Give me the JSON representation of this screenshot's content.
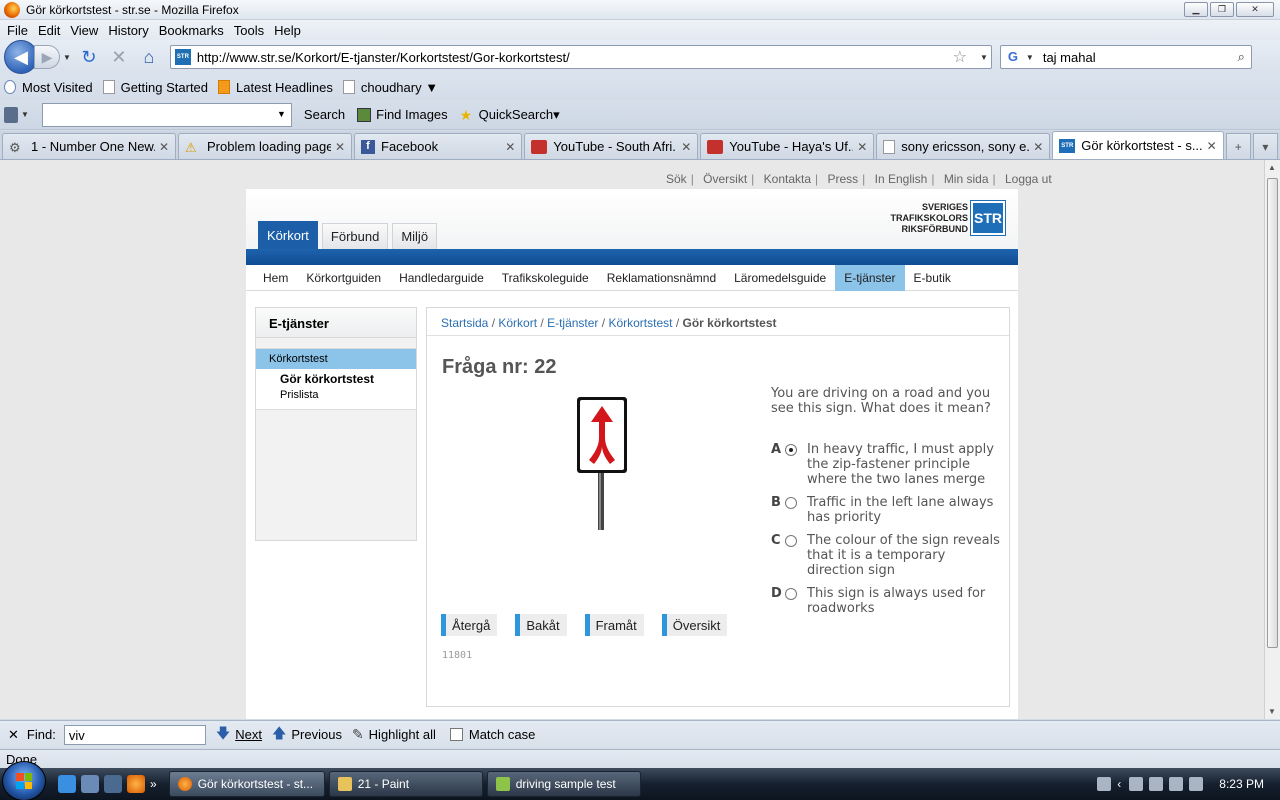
{
  "window": {
    "title": "Gör körkortstest - str.se - Mozilla Firefox"
  },
  "menubar": [
    "File",
    "Edit",
    "View",
    "History",
    "Bookmarks",
    "Tools",
    "Help"
  ],
  "navbar": {
    "url": "http://www.str.se/Korkort/E-tjanster/Korkortstest/Gor-korkortstest/",
    "search_value": "taj mahal"
  },
  "bookmarks": [
    "Most Visited",
    "Getting Started",
    "Latest Headlines",
    "choudhary ▼"
  ],
  "toolbar2": {
    "search_label": "Search",
    "find_images": "Find Images",
    "quicksearch": "QuickSearch▾"
  },
  "tabs": [
    "1 - Number One New...",
    "Problem loading page",
    "Facebook",
    "YouTube - South Afri...",
    "YouTube - Haya's Uf...",
    "sony ericsson, sony e...",
    "Gör körkortstest - s..."
  ],
  "site": {
    "util_links": [
      "Sök",
      "Översikt",
      "Kontakta",
      "Press",
      "In English",
      "Min sida",
      "Logga ut"
    ],
    "logo_lines": [
      "SVERIGES",
      "TRAFIKSKOLORS",
      "RIKSFÖRBUND"
    ],
    "logo_box": "STR",
    "main_nav": [
      "Körkort",
      "Förbund",
      "Miljö"
    ],
    "sub_nav": [
      "Hem",
      "Körkortguiden",
      "Handledarguide",
      "Trafikskoleguide",
      "Reklamationsnämnd",
      "Läromedelsguide",
      "E-tjänster",
      "E-butik"
    ],
    "sidebar": {
      "heading": "E-tjänster",
      "items": [
        "Körkortstest",
        "Gör körkortstest",
        "Prislista"
      ]
    },
    "breadcrumbs": [
      "Startsida",
      "Körkort",
      "E-tjänster",
      "Körkortstest",
      "Gör körkortstest"
    ],
    "question_title": "Fråga nr: 22",
    "question_text": "You are driving on a road and you see this sign. What does it mean?",
    "answers": [
      {
        "letter": "A",
        "text": "In heavy traffic, I must apply the zip-fastener principle where the two lanes merge",
        "selected": true
      },
      {
        "letter": "B",
        "text": "Traffic in the left lane always has priority",
        "selected": false
      },
      {
        "letter": "C",
        "text": "The colour of the sign reveals that it is a temporary direction sign",
        "selected": false
      },
      {
        "letter": "D",
        "text": "This sign is always used for roadworks",
        "selected": false
      }
    ],
    "buttons": [
      "Återgå",
      "Bakåt",
      "Framåt",
      "Översikt"
    ],
    "question_id": "11801"
  },
  "findbar": {
    "label": "Find:",
    "value": "viv",
    "next": "Next",
    "previous": "Previous",
    "highlight": "Highlight all",
    "match_case": "Match case"
  },
  "status": "Done",
  "taskbar": {
    "items": [
      "Gör körkortstest - st...",
      "21 - Paint",
      "driving sample test"
    ],
    "clock": "8:23 PM"
  }
}
